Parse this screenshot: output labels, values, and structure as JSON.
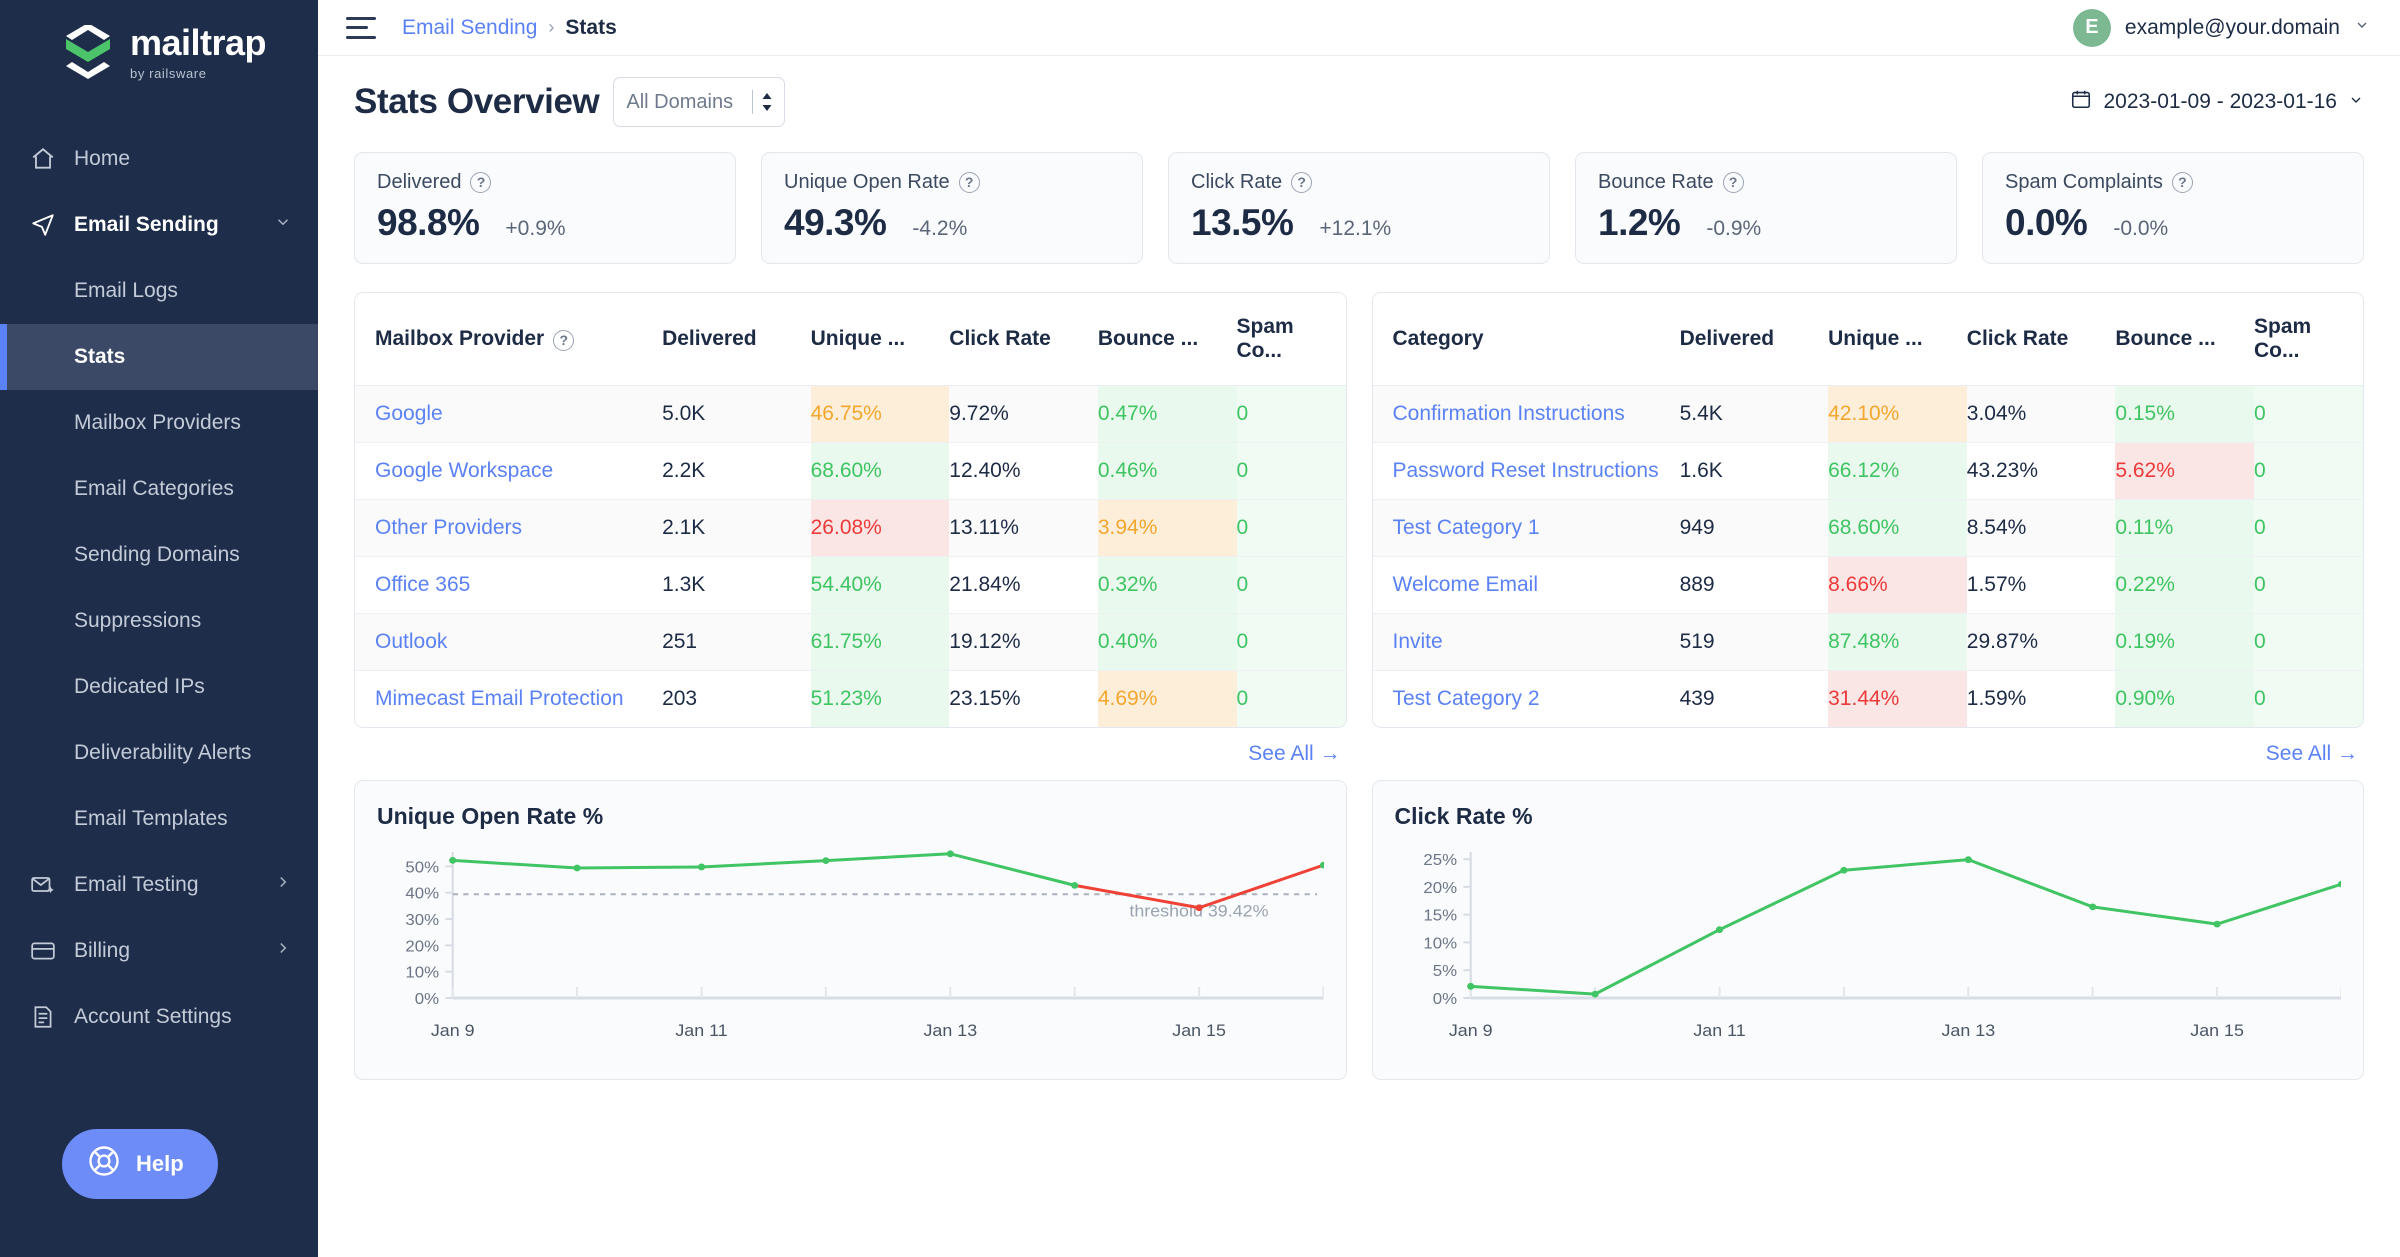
{
  "brand": {
    "name": "mailtrap",
    "tagline": "by railsware",
    "logo_green": "#4cc46a",
    "accent_blue": "#5b82f5"
  },
  "sidebar": {
    "items": [
      {
        "label": "Home",
        "icon": "home-icon",
        "type": "top"
      },
      {
        "label": "Email Sending",
        "icon": "send-icon",
        "type": "top",
        "active": true,
        "chevron": "chevron-down-icon"
      },
      {
        "label": "Email Logs",
        "type": "sub"
      },
      {
        "label": "Stats",
        "type": "sub",
        "active": true
      },
      {
        "label": "Mailbox Providers",
        "type": "sub"
      },
      {
        "label": "Email Categories",
        "type": "sub"
      },
      {
        "label": "Sending Domains",
        "type": "sub"
      },
      {
        "label": "Suppressions",
        "type": "sub"
      },
      {
        "label": "Dedicated IPs",
        "type": "sub"
      },
      {
        "label": "Deliverability Alerts",
        "type": "sub"
      },
      {
        "label": "Email Templates",
        "type": "sub"
      },
      {
        "label": "Email Testing",
        "icon": "envelope-sparkle-icon",
        "type": "top",
        "chevron": "chevron-right-icon"
      },
      {
        "label": "Billing",
        "icon": "card-icon",
        "type": "top",
        "chevron": "chevron-right-icon"
      },
      {
        "label": "Account Settings",
        "icon": "document-icon",
        "type": "top"
      }
    ],
    "help_label": "Help"
  },
  "topbar": {
    "breadcrumb_parent": "Email Sending",
    "breadcrumb_separator": "›",
    "breadcrumb_current": "Stats",
    "user_initial": "E",
    "user_email": "example@your.domain"
  },
  "page": {
    "title": "Stats Overview",
    "domain_filter_value": "All Domains",
    "date_range": "2023-01-09 - 2023-01-16"
  },
  "kpis": [
    {
      "label": "Delivered",
      "value": "98.8%",
      "delta": "+0.9%"
    },
    {
      "label": "Unique Open Rate",
      "value": "49.3%",
      "delta": "-4.2%"
    },
    {
      "label": "Click Rate",
      "value": "13.5%",
      "delta": "+12.1%"
    },
    {
      "label": "Bounce Rate",
      "value": "1.2%",
      "delta": "-0.9%"
    },
    {
      "label": "Spam Complaints",
      "value": "0.0%",
      "delta": "-0.0%"
    }
  ],
  "provider_table": {
    "columns": [
      "Mailbox Provider",
      "Delivered",
      "Unique ...",
      "Click Rate",
      "Bounce ...",
      "Spam Co..."
    ],
    "has_header_help": true,
    "see_all": "See All →",
    "rows": [
      {
        "name": "Google",
        "delivered": "5.0K",
        "unique_open": "46.75%",
        "unique_tone": "orange",
        "click": "9.72%",
        "bounce": "0.47%",
        "bounce_tone": "green",
        "spam": "0"
      },
      {
        "name": "Google Workspace",
        "delivered": "2.2K",
        "unique_open": "68.60%",
        "unique_tone": "green",
        "click": "12.40%",
        "bounce": "0.46%",
        "bounce_tone": "green",
        "spam": "0"
      },
      {
        "name": "Other Providers",
        "delivered": "2.1K",
        "unique_open": "26.08%",
        "unique_tone": "red",
        "click": "13.11%",
        "bounce": "3.94%",
        "bounce_tone": "orange",
        "spam": "0"
      },
      {
        "name": "Office 365",
        "delivered": "1.3K",
        "unique_open": "54.40%",
        "unique_tone": "green",
        "click": "21.84%",
        "bounce": "0.32%",
        "bounce_tone": "green",
        "spam": "0"
      },
      {
        "name": "Outlook",
        "delivered": "251",
        "unique_open": "61.75%",
        "unique_tone": "green",
        "click": "19.12%",
        "bounce": "0.40%",
        "bounce_tone": "green",
        "spam": "0"
      },
      {
        "name": "Mimecast Email Protection",
        "delivered": "203",
        "unique_open": "51.23%",
        "unique_tone": "green",
        "click": "23.15%",
        "bounce": "4.69%",
        "bounce_tone": "orange",
        "spam": "0"
      }
    ]
  },
  "category_table": {
    "columns": [
      "Category",
      "Delivered",
      "Unique ...",
      "Click Rate",
      "Bounce ...",
      "Spam Co..."
    ],
    "has_header_help": false,
    "see_all": "See All →",
    "rows": [
      {
        "name": "Confirmation Instructions",
        "delivered": "5.4K",
        "unique_open": "42.10%",
        "unique_tone": "orange",
        "click": "3.04%",
        "bounce": "0.15%",
        "bounce_tone": "green",
        "spam": "0"
      },
      {
        "name": "Password Reset Instructions",
        "delivered": "1.6K",
        "unique_open": "66.12%",
        "unique_tone": "green",
        "click": "43.23%",
        "bounce": "5.62%",
        "bounce_tone": "red",
        "spam": "0"
      },
      {
        "name": "Test Category 1",
        "delivered": "949",
        "unique_open": "68.60%",
        "unique_tone": "green",
        "click": "8.54%",
        "bounce": "0.11%",
        "bounce_tone": "green",
        "spam": "0"
      },
      {
        "name": "Welcome Email",
        "delivered": "889",
        "unique_open": "8.66%",
        "unique_tone": "red",
        "click": "1.57%",
        "bounce": "0.22%",
        "bounce_tone": "green",
        "spam": "0"
      },
      {
        "name": "Invite",
        "delivered": "519",
        "unique_open": "87.48%",
        "unique_tone": "green",
        "click": "29.87%",
        "bounce": "0.19%",
        "bounce_tone": "green",
        "spam": "0"
      },
      {
        "name": "Test Category 2",
        "delivered": "439",
        "unique_open": "31.44%",
        "unique_tone": "red",
        "click": "1.59%",
        "bounce": "0.90%",
        "bounce_tone": "green",
        "spam": "0"
      }
    ]
  },
  "chart_data": [
    {
      "type": "line",
      "title": "Unique Open Rate %",
      "xlabel": "",
      "ylabel": "",
      "x": [
        "Jan 9",
        "Jan 10",
        "Jan 11",
        "Jan 12",
        "Jan 13",
        "Jan 14",
        "Jan 15",
        "Jan 16"
      ],
      "tick_labels_x": [
        "Jan 9",
        "Jan 11",
        "Jan 13",
        "Jan 15"
      ],
      "tick_labels_y": [
        "0%",
        "10%",
        "20%",
        "30%",
        "40%",
        "50%"
      ],
      "ylim": [
        0,
        57
      ],
      "values": [
        52.3,
        49.4,
        49.8,
        52.2,
        54.8,
        42.8,
        34.3,
        50.5
      ],
      "line_color": "#41c463",
      "below_threshold_color": "#ef4136",
      "threshold": 39.42,
      "threshold_label": "threshold 39.42%",
      "grid": false,
      "legend": "none"
    },
    {
      "type": "line",
      "title": "Click Rate %",
      "xlabel": "",
      "ylabel": "",
      "x": [
        "Jan 9",
        "Jan 10",
        "Jan 11",
        "Jan 12",
        "Jan 13",
        "Jan 14",
        "Jan 15",
        "Jan 16"
      ],
      "tick_labels_x": [
        "Jan 9",
        "Jan 11",
        "Jan 13",
        "Jan 15"
      ],
      "tick_labels_y": [
        "0%",
        "5%",
        "10%",
        "15%",
        "20%",
        "25%"
      ],
      "ylim": [
        0,
        27
      ],
      "values": [
        2.1,
        0.7,
        12.3,
        23.0,
        24.9,
        16.4,
        13.3,
        20.5
      ],
      "line_color": "#41c463",
      "grid": false,
      "legend": "none"
    }
  ]
}
